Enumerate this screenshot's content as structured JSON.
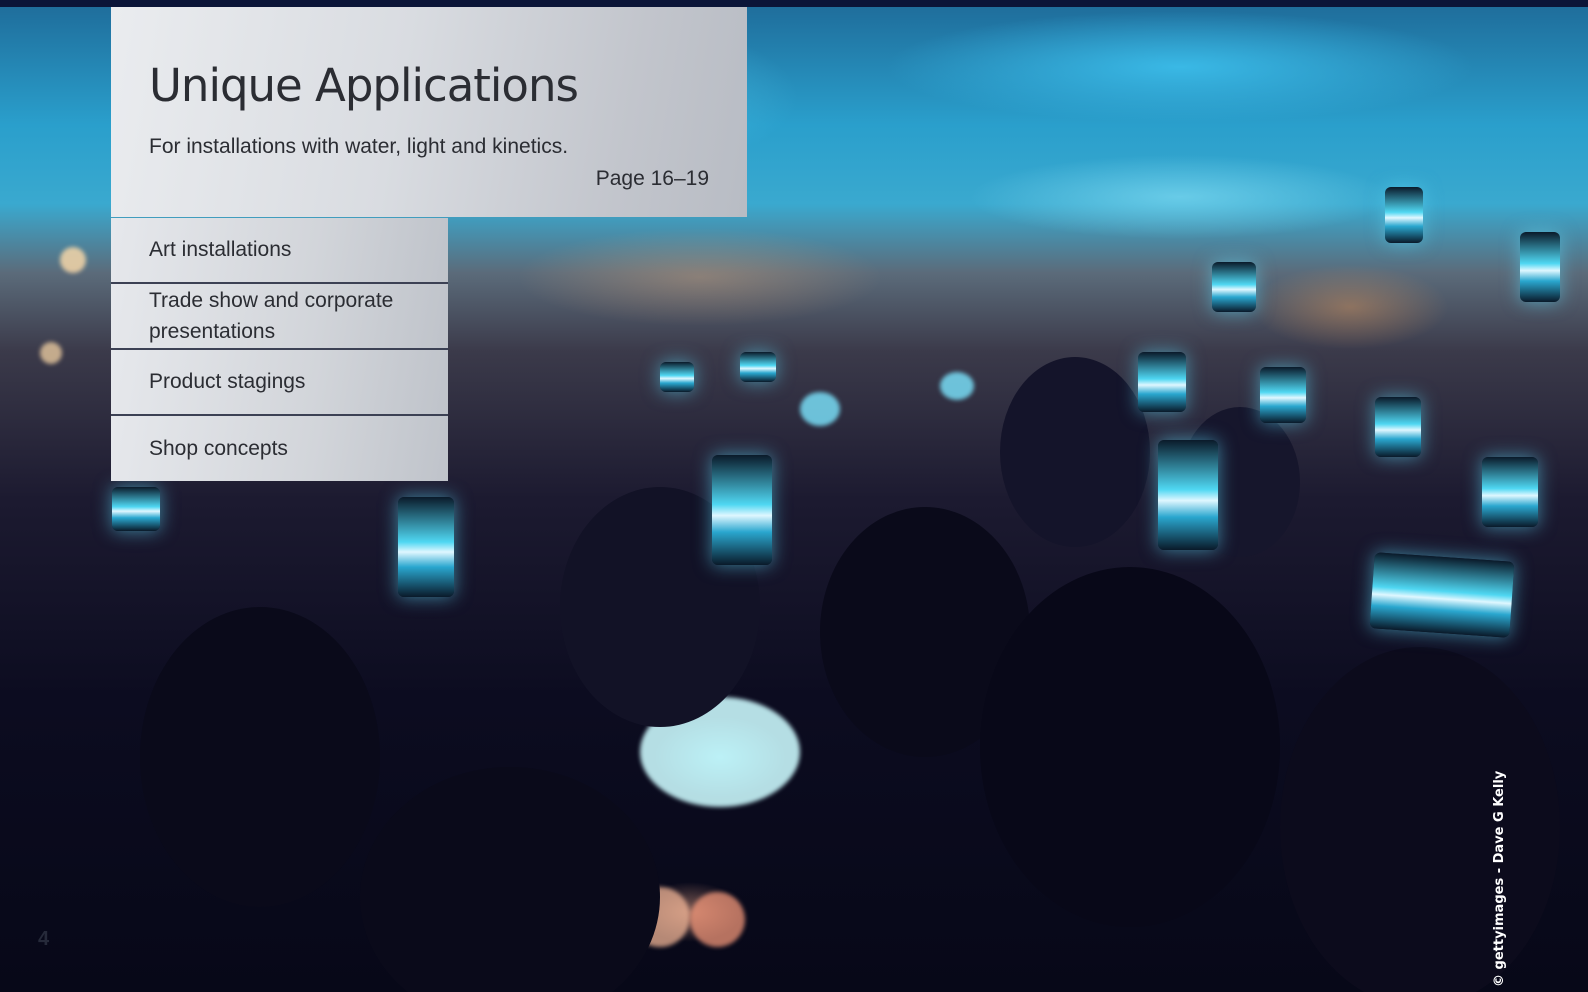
{
  "header": {
    "title": "Unique Applications",
    "subtitle": "For installations with water, light and kinetics.",
    "page_ref": "Page 16–19"
  },
  "menu": {
    "items": [
      {
        "label": "Art installations"
      },
      {
        "label": "Trade show and corporate presentations"
      },
      {
        "label": "Product stagings"
      },
      {
        "label": "Shop concepts"
      }
    ]
  },
  "photo": {
    "credit": "© gettyimages - Dave G Kelly"
  },
  "footer": {
    "page_number": "4"
  },
  "colors": {
    "panel_text": "#2b2d33",
    "accent_dark": "#0b1538",
    "screen_glow": "#4fd7f2"
  }
}
